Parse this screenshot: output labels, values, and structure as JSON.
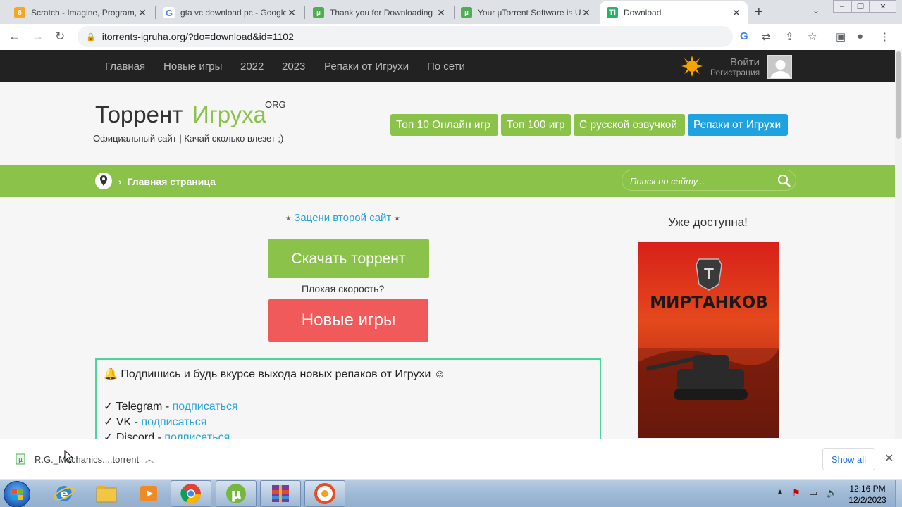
{
  "browser": {
    "tabs": [
      {
        "title": "Scratch - Imagine, Program, Share",
        "active": false
      },
      {
        "title": "gta vc download pc - Google Search",
        "active": false
      },
      {
        "title": "Thank you for Downloading",
        "active": false
      },
      {
        "title": "Your µTorrent Software is Up",
        "active": false
      },
      {
        "title": "Download",
        "active": true
      }
    ],
    "url": "itorrents-igruha.org/?do=download&id=1102"
  },
  "site": {
    "topnav": [
      "Главная",
      "Новые игры",
      "2022",
      "2023",
      "Репаки от Игрухи",
      "По сети"
    ],
    "login": "Войти",
    "register": "Регистрация",
    "logo_part1": "Торрент",
    "logo_part2": "Игруха",
    "logo_suffix": "ORG",
    "tagline": "Официальный сайт | Качай сколько влезет ;)",
    "header_buttons": [
      "Топ 10 Онлайн игр",
      "Топ 100 игр",
      "С русской озвучкой",
      "Репаки от Игрухи"
    ],
    "breadcrumb": "Главная страница",
    "search_placeholder": "Поиск по сайту...",
    "promo_text": "Зацени второй сайт",
    "download_button": "Скачать торрент",
    "bad_speed": "Плохая скорость?",
    "new_games_button": "Новые игры",
    "subscribe_heading": "🔔 Подпишись и будь вкурсе выхода новых репаков от Игрухи ☺",
    "subscribe_items": [
      {
        "prefix": "✓ Telegram - ",
        "link": "подписаться"
      },
      {
        "prefix": "✓ VK - ",
        "link": "подписаться"
      },
      {
        "prefix": "✓ Discord - ",
        "link": "подписаться"
      }
    ],
    "sidebar_title": "Уже доступна!",
    "poster_title": "МИРТАНКОВ"
  },
  "download_shelf": {
    "filename": "R.G._Mechanics....torrent",
    "show_all": "Show all"
  },
  "taskbar": {
    "time": "12:16 PM",
    "date": "12/2/2023"
  }
}
